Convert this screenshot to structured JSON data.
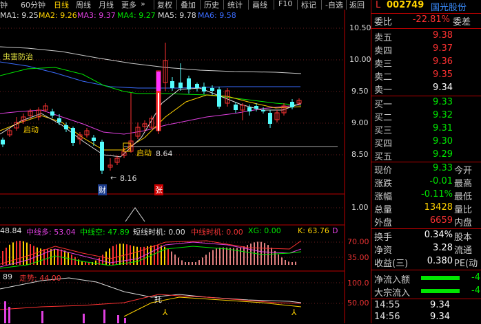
{
  "toolbar": {
    "items": [
      "钟",
      "60分钟",
      "日线",
      "周线",
      "月线",
      "更多",
      "复权",
      "叠加",
      "历史",
      "统计",
      "画线",
      "F10",
      "标记",
      "-自选",
      "返回"
    ],
    "active_index": 2,
    "more_arrow": "»"
  },
  "ma_legend": {
    "ma1": "MA1: 9.25",
    "ma2": "MA2: 9.26",
    "ma3": "MA3: 9.37",
    "ma4": "MA4: 9.27",
    "ma5": "MA5: 9.78",
    "ma6": "MA6: 9.58",
    "prefix": "ma1"
  },
  "chart_labels": {
    "pest": "虫害防治",
    "qidong1": "启动",
    "qidong2": "启动",
    "low_price": "8.16",
    "mark_price": "8.64",
    "cai": "财",
    "zhang": "张",
    "tuo": "托"
  },
  "price_axis": [
    "10.50",
    "10.00",
    "9.50",
    "9.00",
    "8.50"
  ],
  "volume_axis": [
    "1.00"
  ],
  "ind1_axis": [
    "70.00",
    "35.00"
  ],
  "ind2_axis": [
    "100.0",
    "50.00"
  ],
  "ind1_legend": {
    "v0": "48.84",
    "duo": "中线多: 53.04",
    "kong": "中线空: 47.89",
    "dx": "短线时机: 0.00",
    "zx": "中线时机: 0.00",
    "xg": "XG: 0.00",
    "k": "K: 63.76",
    "d": "D"
  },
  "ind2_legend": {
    "v0": "89",
    "zoushi": "走势: 44.00"
  },
  "quote": {
    "flag": "L",
    "code": "002749",
    "name": "国光股份",
    "weibi_label": "委比",
    "weibi_val": "-22.81%",
    "weicha_label": "委差",
    "asks": [
      {
        "label": "卖五",
        "price": "9.38"
      },
      {
        "label": "卖四",
        "price": "9.37"
      },
      {
        "label": "卖三",
        "price": "9.36"
      },
      {
        "label": "卖二",
        "price": "9.35"
      },
      {
        "label": "卖一",
        "price": "9.34"
      }
    ],
    "bids": [
      {
        "label": "买一",
        "price": "9.33"
      },
      {
        "label": "买二",
        "price": "9.32"
      },
      {
        "label": "买三",
        "price": "9.31"
      },
      {
        "label": "买四",
        "price": "9.30"
      },
      {
        "label": "买五",
        "price": "9.29"
      }
    ],
    "stats": [
      {
        "label": "现价",
        "val": "9.33",
        "label2": "今开",
        "color": "green"
      },
      {
        "label": "涨跌",
        "val": "-0.01",
        "label2": "最高",
        "color": "green"
      },
      {
        "label": "涨幅",
        "val": "-0.11%",
        "label2": "最低",
        "color": "green"
      },
      {
        "label": "总量",
        "val": "13428",
        "label2": "量比",
        "color": "yellow"
      },
      {
        "label": "外盘",
        "val": "6659",
        "label2": "内盘",
        "color": "red"
      }
    ],
    "fin": [
      {
        "label": "换手",
        "val": "0.34%",
        "label2": "股本"
      },
      {
        "label": "净资",
        "val": "3.28",
        "label2": "流通"
      },
      {
        "label": "收益(三)",
        "val": "0.380",
        "label2": "PE(动"
      }
    ],
    "flows": [
      {
        "label": "净流入额",
        "val": "-4"
      },
      {
        "label": "大宗流入",
        "val": "-4"
      }
    ],
    "ticks": [
      {
        "time": "14:55",
        "price": "9.34"
      },
      {
        "time": "14:56",
        "price": "9.34"
      }
    ]
  }
}
